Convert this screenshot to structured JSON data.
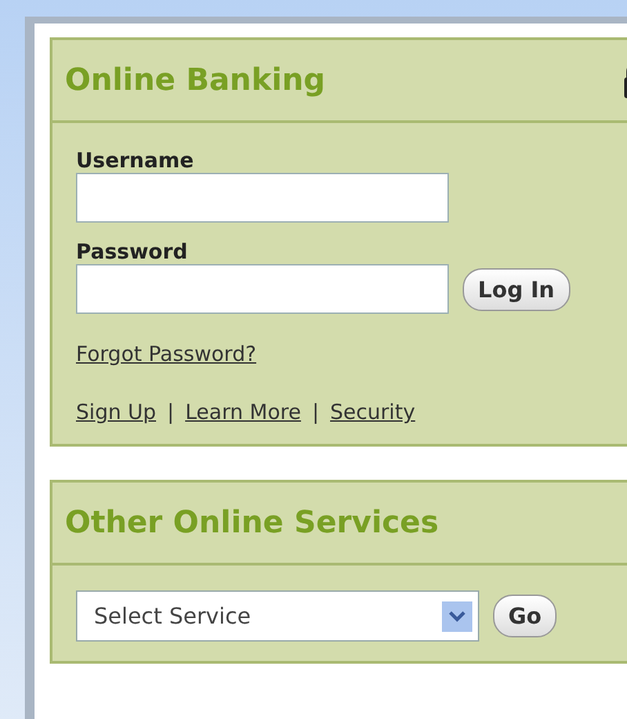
{
  "login_panel": {
    "title": "Online Banking",
    "username_label": "Username",
    "password_label": "Password",
    "login_button": "Log In",
    "forgot_link": "Forgot Password?",
    "links": [
      "Sign Up",
      "Learn More",
      "Security"
    ],
    "separator": "|"
  },
  "services_panel": {
    "title": "Other Online Services",
    "select": {
      "value": "Select Service"
    },
    "go_button": "Go"
  }
}
